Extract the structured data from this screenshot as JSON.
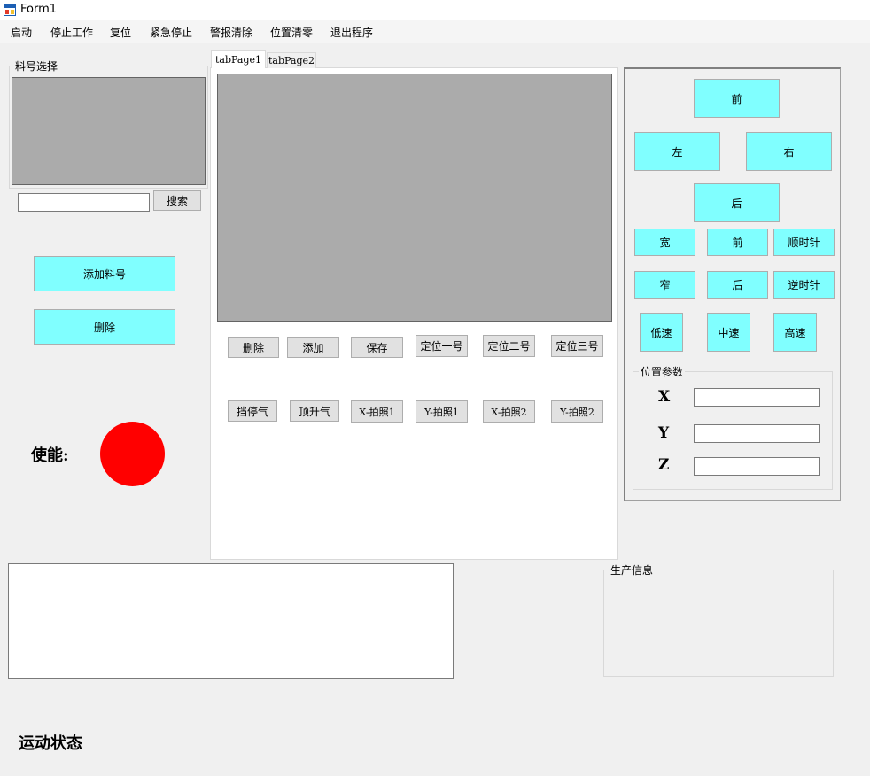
{
  "window": {
    "title": "Form1"
  },
  "menu": [
    "启动",
    "停止工作",
    "复位",
    "紧急停止",
    "警报清除",
    "位置清零",
    "退出程序"
  ],
  "left_panel": {
    "group_title": "料号选择",
    "search_value": "",
    "search_button": "搜索",
    "add_button": "添加料号",
    "delete_button": "删除",
    "enable_label": "使能:",
    "enable_color": "#ff0000"
  },
  "tabs": [
    "tabPage1",
    "tabPage2"
  ],
  "tab_buttons_row1": [
    "删除",
    "添加",
    "保存",
    "定位一号",
    "定位二号",
    "定位三号"
  ],
  "tab_buttons_row2": [
    "挡停气",
    "顶升气",
    "X-拍照1",
    "Y-拍照1",
    "X-拍照2",
    "Y-拍照2"
  ],
  "jog": {
    "forward": "前",
    "left": "左",
    "right": "右",
    "back": "后",
    "wide": "宽",
    "front2": "前",
    "clockwise": "顺时针",
    "narrow": "窄",
    "back2": "后",
    "counterclockwise": "逆时针",
    "speed_low": "低速",
    "speed_mid": "中速",
    "speed_high": "高速"
  },
  "position": {
    "group_title": "位置参数",
    "x_label": "X",
    "x_value": "",
    "y_label": "Y",
    "y_value": "",
    "z_label": "Z",
    "z_value": ""
  },
  "production": {
    "group_title": "生产信息"
  },
  "motion_status_label": "运动状态",
  "colors": {
    "accent_cyan": "#80ffff",
    "enable_red": "#ff0000",
    "grid_gray": "#ababab"
  }
}
